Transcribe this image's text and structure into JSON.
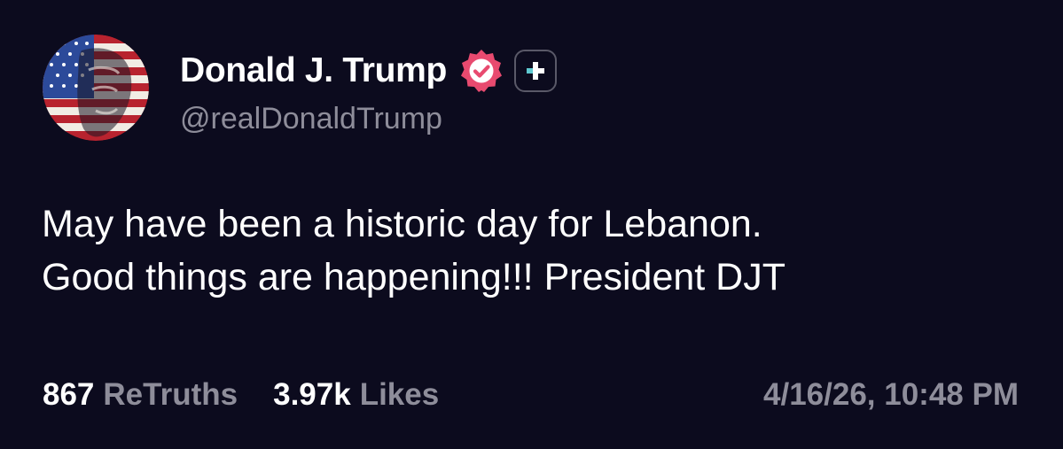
{
  "author": {
    "display_name": "Donald J. Trump",
    "handle": "@realDonaldTrump",
    "avatar_icon": "flag-portrait-avatar",
    "verified_icon": "verified-badge-icon",
    "plus_icon": "plus-badge-icon"
  },
  "post": {
    "lines": [
      "May have been a historic day for Lebanon.",
      "Good things are happening!!! President DJT"
    ]
  },
  "stats": {
    "retruths_count": "867",
    "retruths_label": "ReTruths",
    "likes_count": "3.97k",
    "likes_label": "Likes"
  },
  "timestamp": "4/16/26, 10:48 PM",
  "colors": {
    "background": "#0c0b1e",
    "text_primary": "#ffffff",
    "text_secondary": "#8e8d9a",
    "verified": "#e84a6f",
    "plus_accent": "#5ec9d0"
  }
}
